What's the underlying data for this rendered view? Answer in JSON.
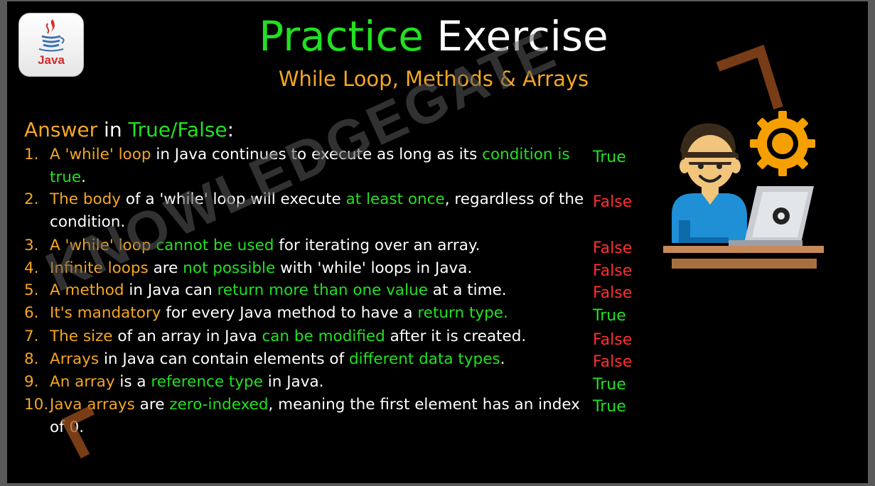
{
  "logo": {
    "text": "Java"
  },
  "title": {
    "part1": "Practice",
    "part2": "Exercise"
  },
  "subtitle": "While Loop, Methods & Arrays",
  "heading": {
    "part1": "Answer",
    "part2": " in ",
    "part3": "True/False",
    "part4": ":"
  },
  "watermark": "KNOWLEDGEGATE",
  "colors": {
    "orange": "#f5a623",
    "green": "#22e022",
    "white": "#ffffff",
    "red": "#ff3030",
    "background": "#000000"
  },
  "statements": [
    {
      "num": "1.",
      "segments": [
        {
          "t": "A 'while' loop",
          "c": "o"
        },
        {
          "t": " in Java continues to execute as long as its ",
          "c": "w"
        },
        {
          "t": "condition is true",
          "c": "g"
        },
        {
          "t": ".",
          "c": "w"
        }
      ]
    },
    {
      "num": "2.",
      "segments": [
        {
          "t": "The body",
          "c": "o"
        },
        {
          "t": " of a 'while' loop will execute ",
          "c": "w"
        },
        {
          "t": "at least once",
          "c": "g"
        },
        {
          "t": ", regardless of the condition.",
          "c": "w"
        }
      ]
    },
    {
      "num": "3.",
      "segments": [
        {
          "t": "A 'while' loop",
          "c": "o"
        },
        {
          "t": " ",
          "c": "w"
        },
        {
          "t": "cannot be used",
          "c": "g"
        },
        {
          "t": " for iterating over an array.",
          "c": "w"
        }
      ]
    },
    {
      "num": "4.",
      "segments": [
        {
          "t": "Infinite loops",
          "c": "o"
        },
        {
          "t": " are ",
          "c": "w"
        },
        {
          "t": "not possible",
          "c": "g"
        },
        {
          "t": " with 'while' loops in Java.",
          "c": "w"
        }
      ]
    },
    {
      "num": "5.",
      "segments": [
        {
          "t": "A method",
          "c": "o"
        },
        {
          "t": " in Java can ",
          "c": "w"
        },
        {
          "t": "return more than one value",
          "c": "g"
        },
        {
          "t": " at a time.",
          "c": "w"
        }
      ]
    },
    {
      "num": "6.",
      "segments": [
        {
          "t": "It's mandatory",
          "c": "o"
        },
        {
          "t": " for every Java method to have a ",
          "c": "w"
        },
        {
          "t": "return type.",
          "c": "g"
        }
      ]
    },
    {
      "num": "7.",
      "segments": [
        {
          "t": "The size",
          "c": "o"
        },
        {
          "t": " of an array in Java ",
          "c": "w"
        },
        {
          "t": "can be modified",
          "c": "g"
        },
        {
          "t": " after it is created.",
          "c": "w"
        }
      ]
    },
    {
      "num": "8.",
      "segments": [
        {
          "t": "Arrays",
          "c": "o"
        },
        {
          "t": " in Java can contain elements of ",
          "c": "w"
        },
        {
          "t": "different data types",
          "c": "g"
        },
        {
          "t": ".",
          "c": "w"
        }
      ]
    },
    {
      "num": "9.",
      "segments": [
        {
          "t": "An array",
          "c": "o"
        },
        {
          "t": " is a ",
          "c": "w"
        },
        {
          "t": "reference type",
          "c": "g"
        },
        {
          "t": " in Java.",
          "c": "w"
        }
      ]
    },
    {
      "num": "10.",
      "segments": [
        {
          "t": "Java arrays",
          "c": "o"
        },
        {
          "t": " are ",
          "c": "w"
        },
        {
          "t": "zero-indexed",
          "c": "g"
        },
        {
          "t": ", meaning the first element has an index of 0.",
          "c": "w"
        }
      ]
    }
  ],
  "answers": [
    {
      "text": "True",
      "c": "g"
    },
    {
      "text": "False",
      "c": "r"
    },
    {
      "text": "False",
      "c": "r"
    },
    {
      "text": "False",
      "c": "r"
    },
    {
      "text": "False",
      "c": "r"
    },
    {
      "text": "True",
      "c": "g"
    },
    {
      "text": "False",
      "c": "r"
    },
    {
      "text": "False",
      "c": "r"
    },
    {
      "text": "True",
      "c": "g"
    },
    {
      "text": "True",
      "c": "g"
    }
  ]
}
